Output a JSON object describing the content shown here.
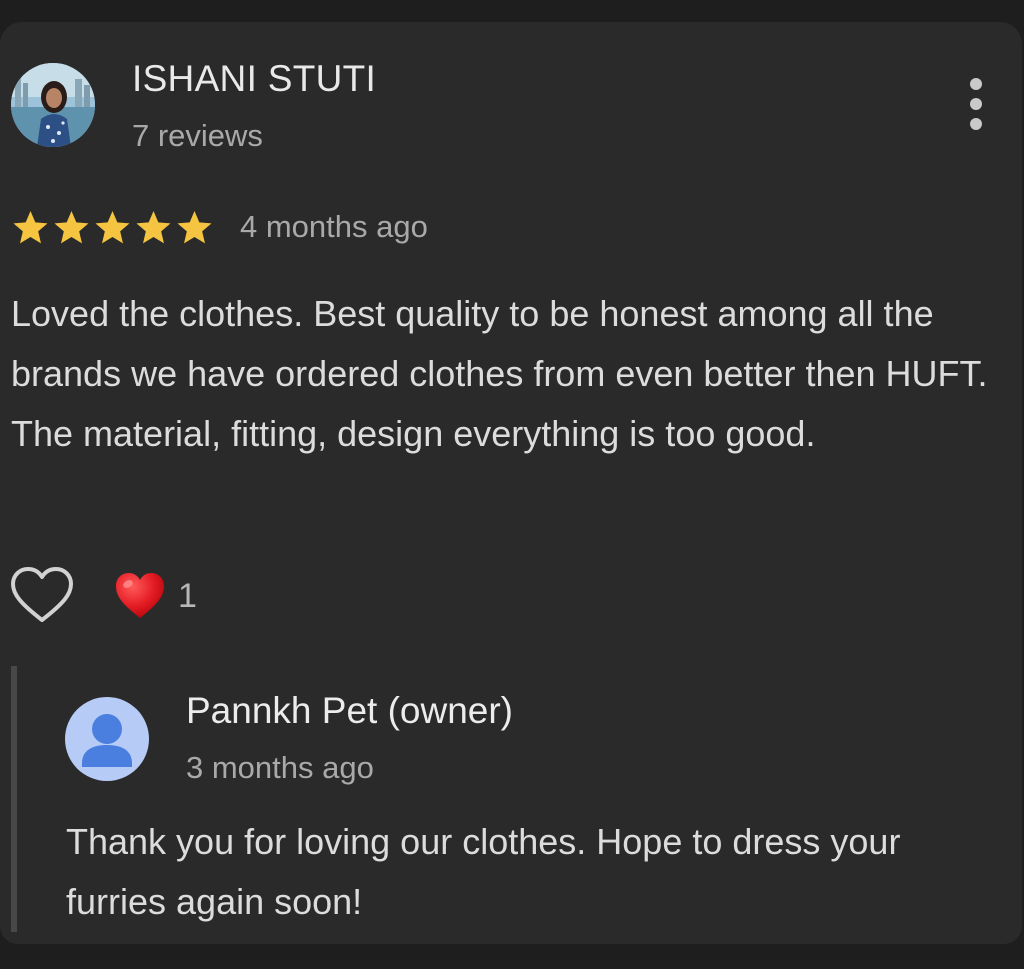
{
  "review": {
    "reviewer_name": "ISHANI STUTI",
    "review_count": "7 reviews",
    "rating": 5,
    "rating_max": 5,
    "star_color": "#f5c542",
    "date": "4 months ago",
    "text": "Loved the clothes. Best quality to be honest among all the brands we have ordered clothes from even better then HUFT. The material, fitting, design everything is too good.",
    "more_icon": "more-vertical-icon",
    "like_icon": "heart-outline-icon",
    "reaction_emoji": "❤️",
    "reaction_count": "1"
  },
  "reply": {
    "owner_name": "Pannkh Pet (owner)",
    "date": "3 months ago",
    "text": "Thank you for loving our clothes. Hope to dress your furries again soon!",
    "avatar_icon": "person-icon",
    "avatar_bg": "#b6ccf7",
    "avatar_fg": "#4a7fe0"
  }
}
